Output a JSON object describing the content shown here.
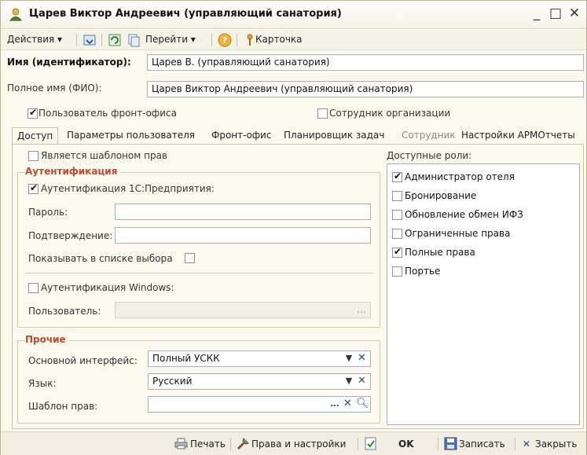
{
  "window": {
    "title": "Царев Виктор Андреевич (управляющий санатория)",
    "minimize_glyph": "_",
    "maximize_glyph": "□",
    "close_glyph": "✕"
  },
  "toolbar": {
    "actions_label": "Действия ▾",
    "goto_label": "Перейти ▾",
    "help_label": "?",
    "card_label": "Карточка"
  },
  "form": {
    "name_label": "Имя (идентификатор):",
    "name_value": "Царев В. (управляющий санатория)",
    "fullname_label": "Полное имя (ФИО):",
    "fullname_value": "Царев Виктор Андреевич (управляющий санатория)",
    "frontoffice_user_label": "Пользователь фронт-офиса",
    "frontoffice_user_checked": true,
    "org_employee_label": "Сотрудник организации",
    "org_employee_checked": false
  },
  "tabs": [
    {
      "label": "Доступ",
      "active": true
    },
    {
      "label": "Параметры пользователя"
    },
    {
      "label": "Фронт-офис"
    },
    {
      "label": "Планировщик задач"
    },
    {
      "label": "Сотрудник",
      "disabled": true
    },
    {
      "label": "Настройки АРМОтчеты"
    }
  ],
  "access": {
    "template_label": "Является шаблоном прав",
    "auth_group_title": "Аутентификация",
    "auth_1c_label": "Аутентификация 1С:Предприятия:",
    "password_label": "Пароль:",
    "password_value": "",
    "confirm_label": "Подтверждение:",
    "confirm_value": "",
    "show_in_list_label": "Показывать в списке выбора",
    "auth_windows_label": "Аутентификация Windows:",
    "win_user_label": "Пользователь:",
    "win_user_value": "",
    "other_group_title": "Прочие",
    "interface_label": "Основной интерфейс:",
    "interface_value": "Полный УСКК",
    "language_label": "Язык:",
    "language_value": "Русский",
    "rights_template_label": "Шаблон прав:",
    "rights_template_value": ""
  },
  "roles": {
    "title": "Доступные роли:",
    "items": [
      {
        "label": "Администратор отеля",
        "checked": true
      },
      {
        "label": "Бронирование",
        "checked": false
      },
      {
        "label": "Обновление обмен ИФЗ",
        "checked": false
      },
      {
        "label": "Ограниченные права",
        "checked": false
      },
      {
        "label": "Полные права",
        "checked": true
      },
      {
        "label": "Портье",
        "checked": false
      }
    ]
  },
  "bottom": {
    "print_label": "Печать",
    "rights_settings_label": "Права и настройки",
    "ok_label": "OK",
    "save_label": "Записать",
    "close_label": "Закрыть"
  },
  "colors": {
    "window_bg": "#fbf9ee",
    "group_title": "#c0492f",
    "field_border": "#a8b0bd"
  }
}
